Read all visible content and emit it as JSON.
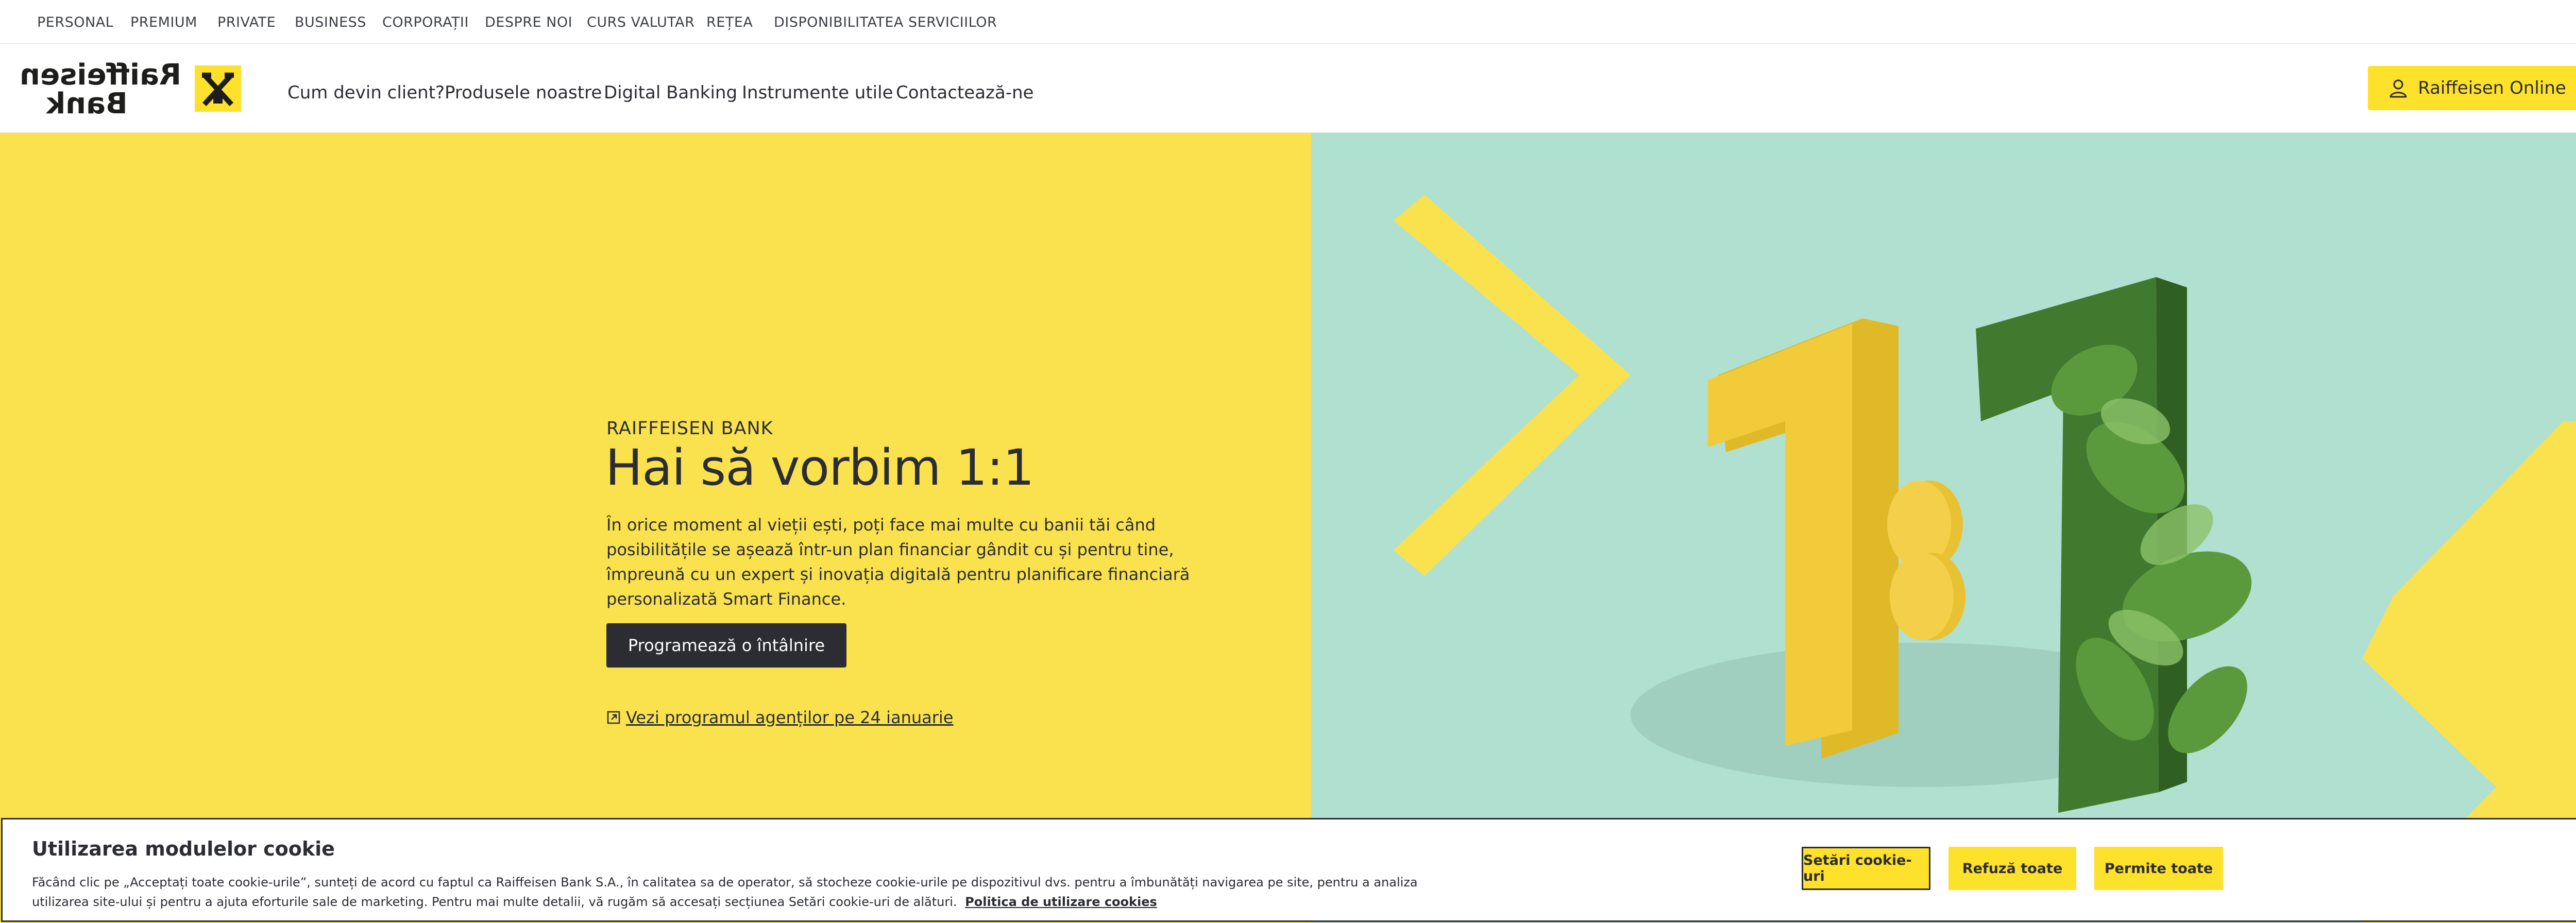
{
  "top_nav": {
    "items": [
      "PERSONAL",
      "PREMIUM",
      "PRIVATE",
      "BUSINESS",
      "CORPORAȚII",
      "DESPRE NOI",
      "CURS VALUTAR",
      "REȚEA",
      "DISPONIBILITATEA SERVICIILOR"
    ]
  },
  "logo": {
    "text": "Raiffeisen Bank"
  },
  "main_nav": {
    "items": [
      "Cum devin client?",
      "Produsele noastre",
      "Digital Banking",
      "Instrumente utile",
      "Contactează-ne"
    ],
    "online_button": "Raiffeisen Online"
  },
  "hero": {
    "eyebrow": "RAIFFEISEN BANK",
    "title": "Hai să vorbim 1:1",
    "description": "În orice moment al vieții ești, poți face mai multe cu banii tăi când posibilitățile se așează într-un plan financiar gândit cu și pentru tine, împreună cu un expert și inovația digitală pentru planificare financiară personalizată Smart Finance.",
    "cta": "Programează o întâlnire",
    "link": "Vezi programul agenților pe 24 ianuarie"
  },
  "cookie_banner": {
    "title": "Utilizarea modulelor cookie",
    "text": "Făcând clic pe „Acceptați toate cookie-urile”, sunteți de acord cu faptul ca Raiffeisen Bank S.A., în calitatea sa de operator, să stocheze cookie-urile pe dispozitivul dvs. pentru a îmbunătăți navigarea pe site, pentru a analiza utilizarea site-ului și pentru a ajuta eforturile sale de marketing. Pentru mai multe detalii, vă rugăm să accesați secțiunea Setări cookie-uri de alături.",
    "policy_link": "Politica de utilizare cookies",
    "buttons": {
      "settings": "Setări cookie-uri",
      "refuse": "Refuză toate",
      "accept": "Permite toate"
    }
  },
  "colors": {
    "brand_yellow": "#fee12b",
    "hero_yellow": "#fae24f",
    "mint": "#b0e0d0",
    "dark": "#2b2d33",
    "leaf_green": "#3f7a2e"
  },
  "icons": {
    "user": "user-icon",
    "external_link": "external-link-icon",
    "logo_mark": "raiffeisen-gable-cross-icon"
  }
}
